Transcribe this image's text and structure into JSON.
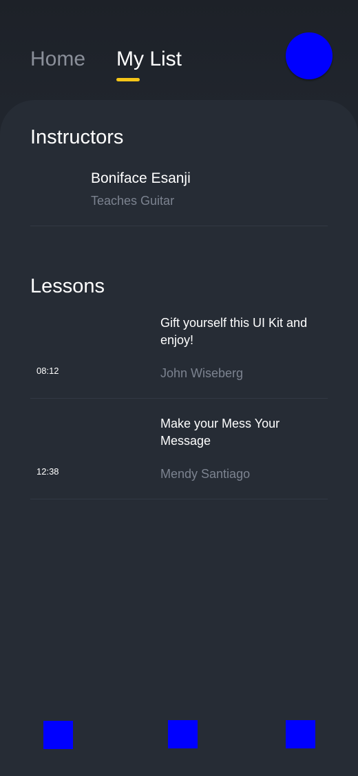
{
  "header": {
    "tabs": [
      {
        "label": "Home",
        "active": false
      },
      {
        "label": "My List",
        "active": true
      }
    ],
    "active_indicator_color": "#f5c518",
    "avatar_color": "#0000ff"
  },
  "instructors": {
    "title": "Instructors",
    "items": [
      {
        "name": "Boniface Esanji",
        "subtitle": "Teaches Guitar"
      }
    ]
  },
  "lessons": {
    "title": "Lessons",
    "items": [
      {
        "duration": "08:12",
        "title": "Gift yourself this UI Kit and enjoy!",
        "author": "John Wiseberg"
      },
      {
        "duration": "12:38",
        "title": "Make your Mess Your Message",
        "author": "Mendy Santiago"
      }
    ]
  },
  "bottom_nav": {
    "items": [
      {
        "icon": "nav-placeholder-icon",
        "color": "#0000ff"
      },
      {
        "icon": "nav-placeholder-icon",
        "color": "#0000ff"
      },
      {
        "icon": "nav-placeholder-icon",
        "color": "#0000ff"
      }
    ]
  }
}
